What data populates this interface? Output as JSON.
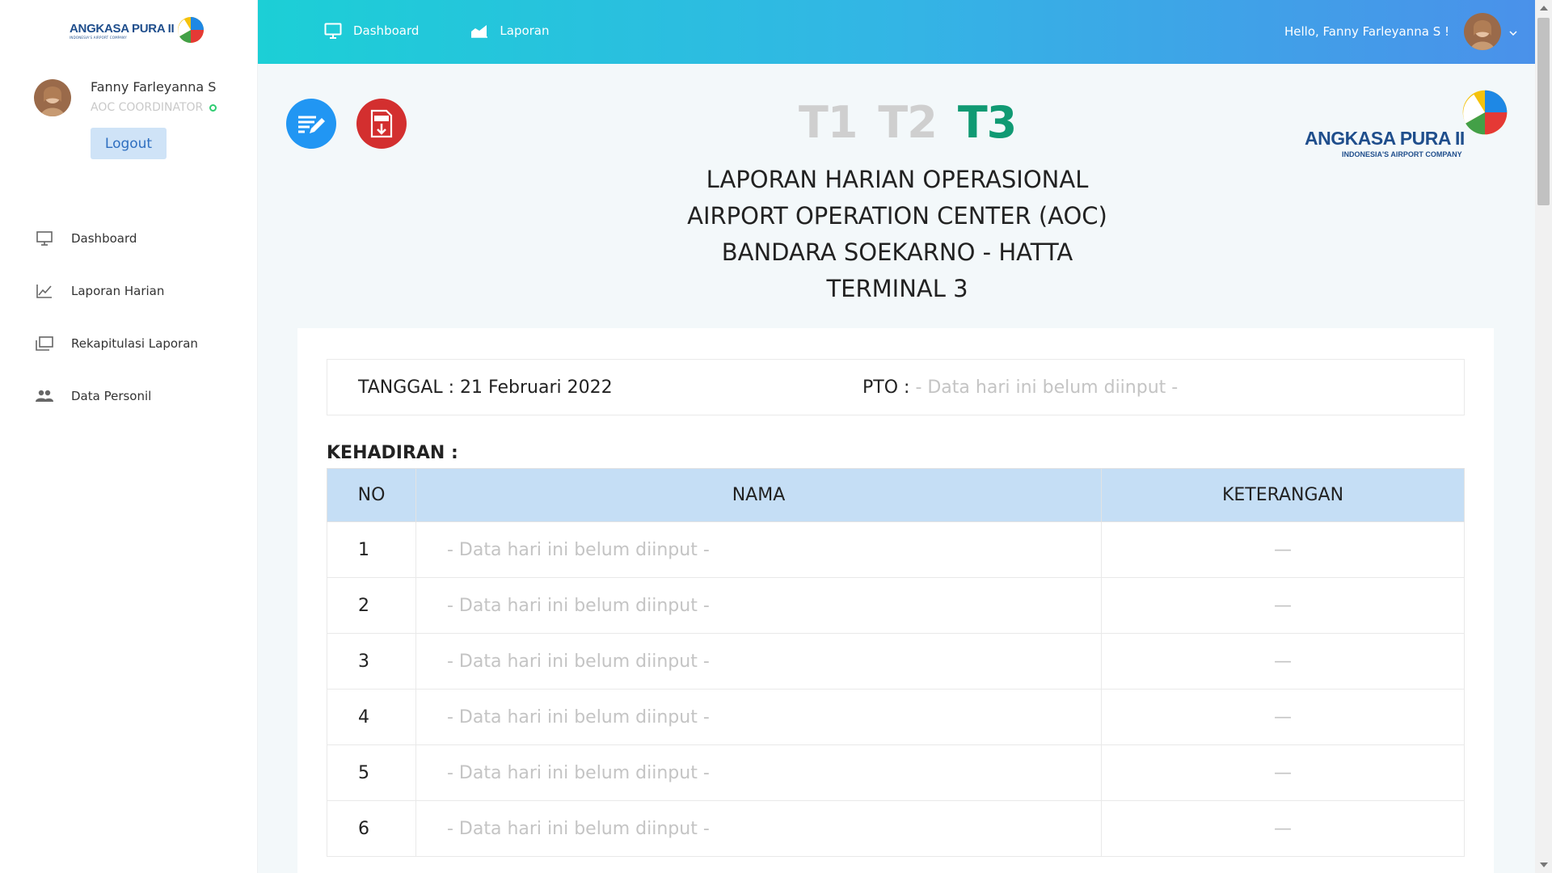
{
  "brand": {
    "name": "ANGKASA PURA II",
    "tagline": "INDONESIA'S AIRPORT COMPANY"
  },
  "user": {
    "name": "Fanny Farleyanna S",
    "role": "AOC COORDINATOR",
    "greeting": "Hello, Fanny Farleyanna S !"
  },
  "sidebar": {
    "logout_label": "Logout",
    "items": [
      {
        "label": "Dashboard",
        "icon": "monitor-icon"
      },
      {
        "label": "Laporan Harian",
        "icon": "line-chart-icon"
      },
      {
        "label": "Rekapitulasi Laporan",
        "icon": "folders-icon"
      },
      {
        "label": "Data Personil",
        "icon": "users-icon"
      }
    ]
  },
  "topnav": {
    "items": [
      {
        "label": "Dashboard",
        "icon": "monitor-icon"
      },
      {
        "label": "Laporan",
        "icon": "area-chart-icon"
      }
    ]
  },
  "terminals": {
    "t1": "T1",
    "t2": "T2",
    "t3": "T3",
    "active": "T3"
  },
  "report": {
    "title_lines": [
      "LAPORAN HARIAN OPERASIONAL",
      "AIRPORT OPERATION CENTER (AOC)",
      "BANDARA SOEKARNO - HATTA",
      "TERMINAL 3"
    ],
    "date_label": "TANGGAL : 21 Februari 2022",
    "pto_label": "PTO :",
    "pto_value": "- Data hari ini belum diinput -",
    "attendance_title": "KEHADIRAN :",
    "columns": {
      "no": "NO",
      "nama": "NAMA",
      "keterangan": "KETERANGAN"
    },
    "rows": [
      {
        "no": "1",
        "nama": "- Data hari ini belum diinput -",
        "keterangan": "—"
      },
      {
        "no": "2",
        "nama": "- Data hari ini belum diinput -",
        "keterangan": "—"
      },
      {
        "no": "3",
        "nama": "- Data hari ini belum diinput -",
        "keterangan": "—"
      },
      {
        "no": "4",
        "nama": "- Data hari ini belum diinput -",
        "keterangan": "—"
      },
      {
        "no": "5",
        "nama": "- Data hari ini belum diinput -",
        "keterangan": "—"
      },
      {
        "no": "6",
        "nama": "- Data hari ini belum diinput -",
        "keterangan": "—"
      }
    ]
  },
  "colors": {
    "accent_start": "#1ccfd6",
    "accent_end": "#4a91ea",
    "active_terminal": "#109a73",
    "table_header": "#c5def5"
  }
}
